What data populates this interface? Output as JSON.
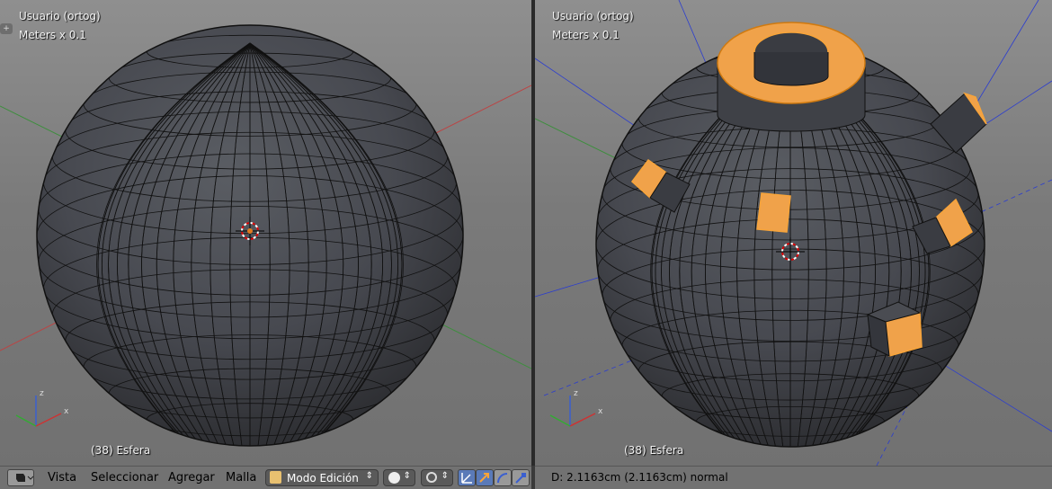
{
  "viewports": [
    {
      "view_name": "Usuario (ortog)",
      "scale": "Meters x 0.1",
      "object": "(38) Esfera"
    },
    {
      "view_name": "Usuario (ortog)",
      "scale": "Meters x 0.1",
      "object": "(38) Esfera"
    }
  ],
  "header": {
    "editor_icon": "view3d-icon",
    "menus": [
      "Vista",
      "Seleccionar",
      "Agregar",
      "Malla"
    ],
    "mode": "Modo Edición",
    "shading_icon": "solid-sphere-icon",
    "pivot_icon": "pivot-icon",
    "manipulators": [
      "manipulator-toggle-icon",
      "translate-icon",
      "rotate-icon",
      "scale-icon"
    ]
  },
  "status": {
    "text": "D: 2.1163cm (2.1163cm) normal"
  },
  "colors": {
    "selection": "#f7a43a",
    "face_fill": "#4a4c52",
    "wire": "#000000",
    "background_top": "#8f8f8f"
  }
}
